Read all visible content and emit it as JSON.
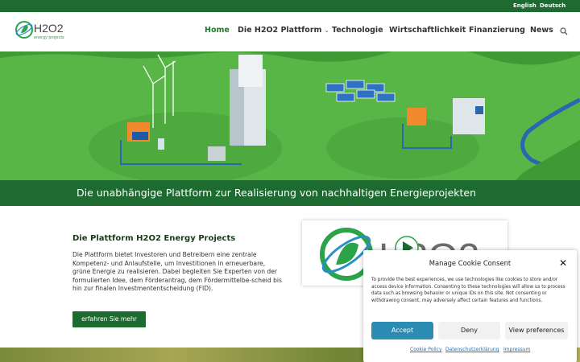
{
  "topbar": {
    "lang_en": "English",
    "lang_de": "Deutsch"
  },
  "logo": {
    "text_main": "H2O2",
    "text_sub": "energy projects"
  },
  "nav": {
    "home": "Home",
    "platform": "Die H2O2 Plattform",
    "technology": "Technologie",
    "economy": "Wirtschaftlichkeit",
    "finance": "Finanzierung",
    "news": "News"
  },
  "hero": {
    "banner_text": "Die unabhängige Plattform zur Realisierung von nachhaltigen Energieprojekten"
  },
  "content": {
    "title": "Die Plattform H2O2 Energy Projects",
    "text": "Die Plattform bietet Investoren und Betreibern eine zentrale Kompetenz- und Anlaufstelle, um Investitionen in erneuerbare, grüne Energie zu realisieren. Dabei begleiten Sie Experten von der formulierten Idee, dem Förderantrag, dem Fördermittelbe-scheid bis hin zur finalen Investmententscheidung (FID).",
    "button": "erfahren Sie mehr"
  },
  "video": {
    "logo_text": "H2O2"
  },
  "cookie": {
    "title": "Manage Cookie Consent",
    "text": "To provide the best experiences, we use technologies like cookies to store and/or access device information. Consenting to these technologies will allow us to process data such as browsing behavior or unique IDs on this site. Not consenting or withdrawing consent, may adversely affect certain features and functions.",
    "accept": "Accept",
    "deny": "Deny",
    "preferences": "View preferences",
    "link_policy": "Cookie Policy",
    "link_privacy": "Datenschutzerklärung",
    "link_imprint": "Impressum"
  },
  "colors": {
    "primary_green": "#1e6b31",
    "hero_green": "#59b845",
    "accept_blue": "#2a8bb3"
  },
  "icons": [
    "search-icon",
    "close-icon",
    "chevron-down-icon",
    "play-icon"
  ]
}
